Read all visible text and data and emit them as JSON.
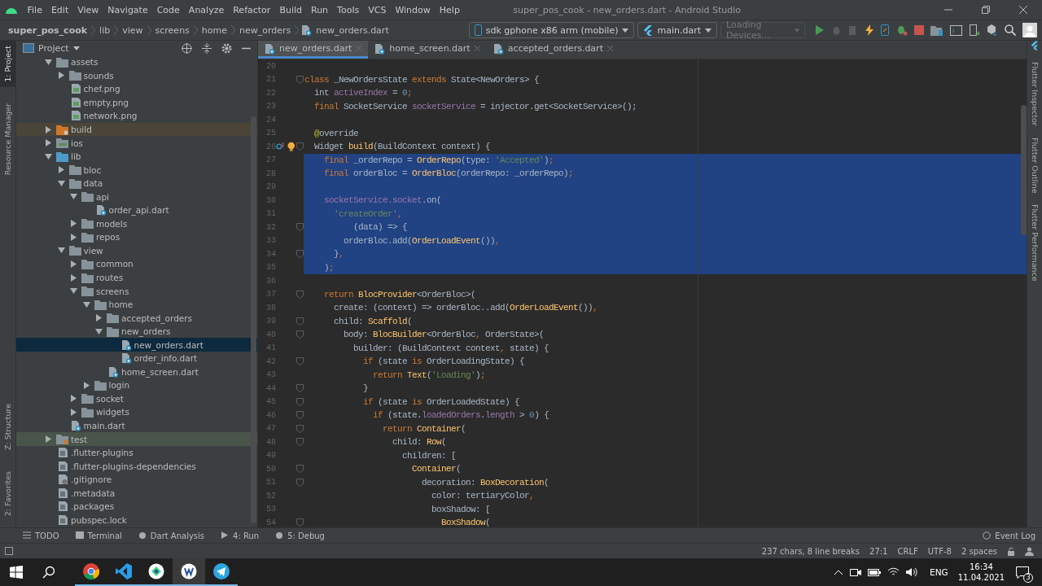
{
  "menu": [
    "File",
    "Edit",
    "View",
    "Navigate",
    "Code",
    "Analyze",
    "Refactor",
    "Build",
    "Run",
    "Tools",
    "VCS",
    "Window",
    "Help"
  ],
  "window": {
    "title": "super_pos_cook - new_orders.dart - Android Studio"
  },
  "breadcrumbs": [
    {
      "label": "super_pos_cook",
      "kind": "project"
    },
    {
      "label": "lib",
      "kind": "dir"
    },
    {
      "label": "view",
      "kind": "dir"
    },
    {
      "label": "screens",
      "kind": "dir"
    },
    {
      "label": "home",
      "kind": "dir"
    },
    {
      "label": "new_orders",
      "kind": "dir"
    },
    {
      "label": "new_orders.dart",
      "kind": "file"
    }
  ],
  "toolbar": {
    "device": "sdk gphone x86 arm (mobile)",
    "config": "main.dart",
    "devices_placeholder": "Loading Devices..."
  },
  "left_tabs": [
    {
      "label": "1: Project",
      "selected": true
    },
    {
      "label": "Resource Manager",
      "selected": false
    },
    {
      "label": "Z: Structure",
      "selected": false
    },
    {
      "label": "2: Favorites",
      "selected": false
    }
  ],
  "right_tabs": [
    "Flutter Inspector",
    "Flutter Outline",
    "Flutter Performance"
  ],
  "project_panel": {
    "title": "Project"
  },
  "tree": [
    {
      "name": "assets",
      "kind": "folder",
      "expanded": true,
      "selected": false,
      "children": [
        {
          "name": "sounds",
          "kind": "folder",
          "expanded": false,
          "selected": false
        },
        {
          "name": "chef.png",
          "kind": "image",
          "selected": false
        },
        {
          "name": "empty.png",
          "kind": "image",
          "selected": false
        },
        {
          "name": "network.png",
          "kind": "image",
          "selected": false
        }
      ]
    },
    {
      "name": "build",
      "kind": "excluded",
      "expanded": false,
      "selected": false
    },
    {
      "name": "ios",
      "kind": "ios",
      "expanded": false,
      "selected": false
    },
    {
      "name": "lib",
      "kind": "source",
      "expanded": true,
      "selected": false,
      "children": [
        {
          "name": "bloc",
          "kind": "folder",
          "expanded": false,
          "selected": false
        },
        {
          "name": "data",
          "kind": "folder",
          "expanded": true,
          "selected": false,
          "children": [
            {
              "name": "api",
              "kind": "folder",
              "expanded": true,
              "selected": false,
              "children": [
                {
                  "name": "order_api.dart",
                  "kind": "dart",
                  "selected": false
                }
              ]
            },
            {
              "name": "models",
              "kind": "folder",
              "expanded": false,
              "selected": false
            },
            {
              "name": "repos",
              "kind": "folder",
              "expanded": false,
              "selected": false
            }
          ]
        },
        {
          "name": "view",
          "kind": "folder",
          "expanded": true,
          "selected": false,
          "children": [
            {
              "name": "common",
              "kind": "folder",
              "expanded": false,
              "selected": false
            },
            {
              "name": "routes",
              "kind": "folder",
              "expanded": false,
              "selected": false
            },
            {
              "name": "screens",
              "kind": "folder",
              "expanded": true,
              "selected": false,
              "children": [
                {
                  "name": "home",
                  "kind": "folder",
                  "expanded": true,
                  "selected": false,
                  "children": [
                    {
                      "name": "accepted_orders",
                      "kind": "folder",
                      "expanded": false,
                      "selected": false
                    },
                    {
                      "name": "new_orders",
                      "kind": "folder",
                      "expanded": true,
                      "selected": false,
                      "children": [
                        {
                          "name": "new_orders.dart",
                          "kind": "dart",
                          "selected": true
                        },
                        {
                          "name": "order_info.dart",
                          "kind": "dart",
                          "selected": false
                        }
                      ]
                    },
                    {
                      "name": "home_screen.dart",
                      "kind": "dart",
                      "selected": false
                    }
                  ]
                },
                {
                  "name": "login",
                  "kind": "folder",
                  "expanded": false,
                  "selected": false
                }
              ]
            },
            {
              "name": "socket",
              "kind": "folder",
              "expanded": false,
              "selected": false
            },
            {
              "name": "widgets",
              "kind": "folder",
              "expanded": false,
              "selected": false
            }
          ]
        },
        {
          "name": "main.dart",
          "kind": "dart",
          "selected": false
        }
      ]
    },
    {
      "name": "test",
      "kind": "test",
      "expanded": false,
      "selected": false
    },
    {
      "name": ".flutter-plugins",
      "kind": "text",
      "selected": false
    },
    {
      "name": ".flutter-plugins-dependencies",
      "kind": "text",
      "selected": false
    },
    {
      "name": ".gitignore",
      "kind": "git",
      "selected": false
    },
    {
      "name": ".metadata",
      "kind": "text",
      "selected": false
    },
    {
      "name": ".packages",
      "kind": "text",
      "selected": false
    },
    {
      "name": "pubspec.lock",
      "kind": "text",
      "selected": false
    }
  ],
  "editor_tabs": [
    {
      "label": "new_orders.dart",
      "selected": true
    },
    {
      "label": "home_screen.dart",
      "selected": false
    },
    {
      "label": "accepted_orders.dart",
      "selected": false
    }
  ],
  "code": [
    {
      "number": "20",
      "selected": false,
      "fold": false
    },
    {
      "number": "21",
      "selected": false,
      "fold": true,
      "tokens": [
        {
          "kind": "keyword",
          "text": "class "
        },
        {
          "kind": "plain",
          "text": "_NewOrdersState "
        },
        {
          "kind": "keyword",
          "text": "extends "
        },
        {
          "kind": "plain",
          "text": "State<NewOrders> {"
        }
      ]
    },
    {
      "number": "22",
      "selected": false,
      "fold": false,
      "tokens": [
        {
          "kind": "plain",
          "text": "  int "
        },
        {
          "kind": "field",
          "text": "activeIndex"
        },
        {
          "kind": "plain",
          "text": " = "
        },
        {
          "kind": "number",
          "text": "0"
        },
        {
          "kind": "keyword",
          "text": ";"
        }
      ]
    },
    {
      "number": "23",
      "selected": false,
      "fold": false,
      "tokens": [
        {
          "kind": "keyword",
          "text": "  final "
        },
        {
          "kind": "plain",
          "text": "SocketService "
        },
        {
          "kind": "field",
          "text": "socketService"
        },
        {
          "kind": "plain",
          "text": " = injector.get<SocketService>();"
        }
      ]
    },
    {
      "number": "24",
      "selected": false,
      "fold": false
    },
    {
      "number": "25",
      "selected": false,
      "fold": false,
      "tokens": [
        {
          "kind": "annotation",
          "text": "  @"
        },
        {
          "kind": "plain",
          "text": "override"
        }
      ]
    },
    {
      "number": "26",
      "selected": false,
      "fold": true,
      "markers": [
        {
          "kind": "override"
        },
        {
          "kind": "bulb"
        }
      ],
      "tokens": [
        {
          "kind": "plain",
          "text": "  Widget "
        },
        {
          "kind": "call",
          "text": "build"
        },
        {
          "kind": "plain",
          "text": "(BuildContext context) {"
        }
      ]
    },
    {
      "number": "27",
      "selected": true,
      "fold": false,
      "tokens": [
        {
          "kind": "keyword",
          "text": "    final "
        },
        {
          "kind": "plain",
          "text": "_orderRepo = "
        },
        {
          "kind": "call",
          "text": "OrderRepo"
        },
        {
          "kind": "plain",
          "text": "(type: "
        },
        {
          "kind": "string",
          "text": "'Accepted'"
        },
        {
          "kind": "plain",
          "text": ")"
        },
        {
          "kind": "keyword",
          "text": ";"
        }
      ]
    },
    {
      "number": "28",
      "selected": true,
      "fold": false,
      "tokens": [
        {
          "kind": "keyword",
          "text": "    final "
        },
        {
          "kind": "plain",
          "text": "orderBloc = "
        },
        {
          "kind": "call",
          "text": "OrderBloc"
        },
        {
          "kind": "plain",
          "text": "(orderRepo: _orderRepo)"
        },
        {
          "kind": "keyword",
          "text": ";"
        }
      ]
    },
    {
      "number": "29",
      "selected": true,
      "fold": false
    },
    {
      "number": "30",
      "selected": true,
      "fold": false,
      "tokens": [
        {
          "kind": "field",
          "text": "    socketService.socket"
        },
        {
          "kind": "plain",
          "text": ".on("
        }
      ]
    },
    {
      "number": "31",
      "selected": true,
      "fold": false,
      "tokens": [
        {
          "kind": "string",
          "text": "      'createOrder'"
        },
        {
          "kind": "keyword",
          "text": ","
        }
      ]
    },
    {
      "number": "32",
      "selected": true,
      "fold": true,
      "tokens": [
        {
          "kind": "plain",
          "text": "          (data) => {"
        }
      ]
    },
    {
      "number": "33",
      "selected": true,
      "fold": false,
      "tokens": [
        {
          "kind": "plain",
          "text": "        orderBloc.add("
        },
        {
          "kind": "call",
          "text": "OrderLoadEvent"
        },
        {
          "kind": "plain",
          "text": "())"
        },
        {
          "kind": "keyword",
          "text": ","
        }
      ]
    },
    {
      "number": "34",
      "selected": true,
      "fold": true,
      "tokens": [
        {
          "kind": "plain",
          "text": "      }"
        },
        {
          "kind": "keyword",
          "text": ","
        }
      ]
    },
    {
      "number": "35",
      "selected": true,
      "fold": false,
      "tokens": [
        {
          "kind": "plain",
          "text": "    )"
        },
        {
          "kind": "keyword",
          "text": ";"
        }
      ]
    },
    {
      "number": "36",
      "selected": false,
      "fold": false
    },
    {
      "number": "37",
      "selected": false,
      "fold": true,
      "tokens": [
        {
          "kind": "keyword",
          "text": "    return "
        },
        {
          "kind": "call",
          "text": "BlocProvider"
        },
        {
          "kind": "plain",
          "text": "<OrderBloc>("
        }
      ]
    },
    {
      "number": "38",
      "selected": false,
      "fold": false,
      "tokens": [
        {
          "kind": "plain",
          "text": "      create: (context) => orderBloc..add("
        },
        {
          "kind": "call",
          "text": "OrderLoadEvent"
        },
        {
          "kind": "plain",
          "text": "())"
        },
        {
          "kind": "keyword",
          "text": ","
        }
      ]
    },
    {
      "number": "39",
      "selected": false,
      "fold": true,
      "tokens": [
        {
          "kind": "plain",
          "text": "      child: "
        },
        {
          "kind": "call",
          "text": "Scaffold"
        },
        {
          "kind": "plain",
          "text": "("
        }
      ]
    },
    {
      "number": "40",
      "selected": false,
      "fold": true,
      "tokens": [
        {
          "kind": "plain",
          "text": "        body: "
        },
        {
          "kind": "call",
          "text": "BlocBuilder"
        },
        {
          "kind": "plain",
          "text": "<OrderBloc"
        },
        {
          "kind": "keyword",
          "text": ", "
        },
        {
          "kind": "plain",
          "text": "OrderState>("
        }
      ]
    },
    {
      "number": "41",
      "selected": false,
      "fold": false,
      "tokens": [
        {
          "kind": "plain",
          "text": "          builder: (BuildContext context"
        },
        {
          "kind": "keyword",
          "text": ", "
        },
        {
          "kind": "plain",
          "text": "state) {"
        }
      ]
    },
    {
      "number": "42",
      "selected": false,
      "fold": true,
      "tokens": [
        {
          "kind": "keyword",
          "text": "            if "
        },
        {
          "kind": "plain",
          "text": "(state "
        },
        {
          "kind": "keyword",
          "text": "is "
        },
        {
          "kind": "plain",
          "text": "OrderLoadingState) {"
        }
      ]
    },
    {
      "number": "43",
      "selected": false,
      "fold": false,
      "tokens": [
        {
          "kind": "keyword",
          "text": "              return "
        },
        {
          "kind": "call",
          "text": "Text"
        },
        {
          "kind": "plain",
          "text": "("
        },
        {
          "kind": "string",
          "text": "'Loading'"
        },
        {
          "kind": "plain",
          "text": ")"
        },
        {
          "kind": "keyword",
          "text": ";"
        }
      ]
    },
    {
      "number": "44",
      "selected": false,
      "fold": true,
      "tokens": [
        {
          "kind": "plain",
          "text": "            }"
        }
      ]
    },
    {
      "number": "45",
      "selected": false,
      "fold": true,
      "tokens": [
        {
          "kind": "keyword",
          "text": "            if "
        },
        {
          "kind": "plain",
          "text": "(state "
        },
        {
          "kind": "keyword",
          "text": "is "
        },
        {
          "kind": "plain",
          "text": "OrderLoadedState) {"
        }
      ]
    },
    {
      "number": "46",
      "selected": false,
      "fold": true,
      "tokens": [
        {
          "kind": "keyword",
          "text": "              if "
        },
        {
          "kind": "plain",
          "text": "(state."
        },
        {
          "kind": "field",
          "text": "loadedOrders"
        },
        {
          "kind": "plain",
          "text": "."
        },
        {
          "kind": "field",
          "text": "length"
        },
        {
          "kind": "plain",
          "text": " > "
        },
        {
          "kind": "number",
          "text": "0"
        },
        {
          "kind": "plain",
          "text": ") {"
        }
      ]
    },
    {
      "number": "47",
      "selected": false,
      "fold": true,
      "tokens": [
        {
          "kind": "keyword",
          "text": "                return "
        },
        {
          "kind": "call",
          "text": "Container"
        },
        {
          "kind": "plain",
          "text": "("
        }
      ]
    },
    {
      "number": "48",
      "selected": false,
      "fold": true,
      "tokens": [
        {
          "kind": "plain",
          "text": "                  child: "
        },
        {
          "kind": "call",
          "text": "Row"
        },
        {
          "kind": "plain",
          "text": "("
        }
      ]
    },
    {
      "number": "49",
      "selected": false,
      "fold": false,
      "tokens": [
        {
          "kind": "plain",
          "text": "                    children: ["
        }
      ]
    },
    {
      "number": "50",
      "selected": false,
      "fold": true,
      "tokens": [
        {
          "kind": "call",
          "text": "                      Container"
        },
        {
          "kind": "plain",
          "text": "("
        }
      ]
    },
    {
      "number": "51",
      "selected": false,
      "fold": true,
      "tokens": [
        {
          "kind": "plain",
          "text": "                        decoration: "
        },
        {
          "kind": "call",
          "text": "BoxDecoration"
        },
        {
          "kind": "plain",
          "text": "("
        }
      ]
    },
    {
      "number": "52",
      "selected": false,
      "fold": false,
      "tokens": [
        {
          "kind": "plain",
          "text": "                          color: tertiaryColor"
        },
        {
          "kind": "keyword",
          "text": ","
        }
      ]
    },
    {
      "number": "53",
      "selected": false,
      "fold": false,
      "tokens": [
        {
          "kind": "plain",
          "text": "                          boxShadow: ["
        }
      ]
    },
    {
      "number": "54",
      "selected": false,
      "fold": true,
      "tokens": [
        {
          "kind": "call",
          "text": "                            BoxShadow"
        },
        {
          "kind": "plain",
          "text": "("
        }
      ]
    }
  ],
  "tool_tabs": [
    {
      "label": "TODO",
      "kind": "list"
    },
    {
      "label": "Terminal",
      "kind": "terminal"
    },
    {
      "label": "Dart Analysis",
      "kind": "analysis"
    },
    {
      "label": "4: Run",
      "kind": "run"
    },
    {
      "label": "5: Debug",
      "kind": "debug"
    }
  ],
  "event_log": "Event Log",
  "status": [
    "237 chars, 8 line breaks",
    "27:1",
    "CRLF",
    "UTF-8",
    "2 spaces"
  ],
  "taskbar": {
    "language": "ENG",
    "time": "16:34",
    "date": "11.04.2021",
    "notifications": "3"
  }
}
